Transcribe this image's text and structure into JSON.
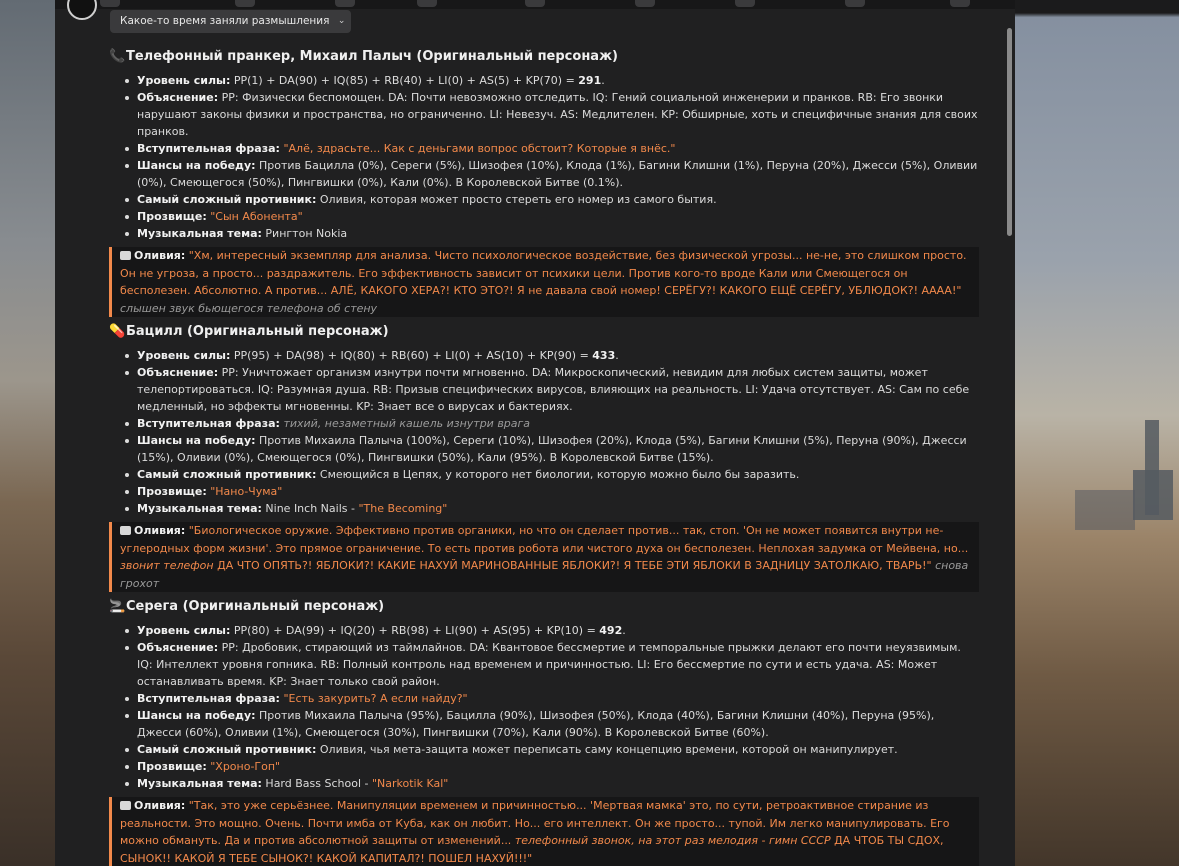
{
  "thought_button": "Какое-то время заняли размышления",
  "labels": {
    "power": "Уровень силы:",
    "explanation": "Объяснение:",
    "intro": "Вступительная фраза:",
    "chances": "Шансы на победу:",
    "hardest": "Самый сложный противник:",
    "nickname": "Прозвище:",
    "music": "Музыкальная тема:",
    "olivia": "Оливия:"
  },
  "chars": [
    {
      "emoji": "📞",
      "title": "Телефонный пранкер, Михаил Палыч (Оригинальный персонаж)",
      "power_formula": "PP(1) + DA(90) + IQ(85) + RB(40) + LI(0) + AS(5) + KP(70) = ",
      "power_total": "291",
      "power_end": ".",
      "explanation": "PP: Физически беспомощен. DA: Почти невозможно отследить. IQ: Гений социальной инженерии и пранков. RB: Его звонки нарушают законы физики и пространства, но ограниченно. LI: Невезуч. AS: Медлителен. KP: Обширные, хоть и специфичные знания для своих пранков.",
      "intro": "\"Алё, здрасьте... Как с деньгами вопрос обстоит? Которые я внёс.\"",
      "chances": "Против Бацилла (0%), Сереги (5%), Шизофея (10%), Клода (1%), Багини Клишни (1%), Перуна (20%), Джесси (5%), Оливии (0%), Смеющегося (50%), Пингвишки (0%), Кали (0%). В Королевской Битве (0.1%).",
      "hardest": "Оливия, которая может просто стереть его номер из самого бытия.",
      "nickname": "\"Сын Абонента\"",
      "music_plain": "Рингтон Nokia",
      "music_hl": "",
      "olivia_quote": "\"Хм, интересный экземпляр для анализа. Чисто психологическое воздействие, без физической угрозы... не-не, это слишком просто. Он не угроза, а просто... раздражитель. Его эффективность зависит от психики цели. Против кого-то вроде Кали или Смеющегося он бесполезен. Абсолютно. А против... АЛЁ, КАКОГО ХЕРА?! КТО ЭТО?! Я не давала свой номер! СЕРЁГУ?! КАКОГО ЕЩЁ СЕРЁГУ, УБЛЮДОК?! ААAA!\"",
      "olivia_action": " слышен звук бьющегося телефона об стену"
    },
    {
      "emoji": "💊",
      "title": "Бацилл (Оригинальный персонаж)",
      "power_formula": "PP(95) + DA(98) + IQ(80) + RB(60) + LI(0) + AS(10) + KP(90) = ",
      "power_total": "433",
      "power_end": ".",
      "explanation": "PP: Уничтожает организм изнутри почти мгновенно. DA: Микроскопический, невидим для любых систем защиты, может телепортироваться. IQ: Разумная душа. RB: Призыв специфических вирусов, влияющих на реальность. LI: Удача отсутствует. AS: Сам по себе медленный, но эффекты мгновенны. KP: Знает все о вирусах и бактериях.",
      "intro_italic": "тихий, незаметный кашель изнутри врага",
      "chances": "Против Михаила Палыча (100%), Сереги (10%), Шизофея (20%), Клода (5%), Багини Клишни (5%), Перуна (90%), Джесси (15%), Оливии (0%), Смеющегося (0%), Пингвишки (50%), Кали (95%). В Королевской Битве (15%).",
      "hardest": "Смеющийся в Цепях, у которого нет биологии, которую можно было бы заразить.",
      "nickname": "\"Нано-Чума\"",
      "music_plain": "Nine Inch Nails - ",
      "music_hl": "\"The Becoming\"",
      "olivia_quote": "\"Биологическое оружие. Эффективно против органики, но что он сделает против... так, стоп. 'Он не может появится внутри не-углеродных форм жизни'. Это прямое ограничение. То есть против робота или чистого духа он бесполезен. Неплохая задумка от Мейвена, но... ",
      "olivia_italic": "звонит телефон",
      "olivia_quote2": " ДА ЧТО ОПЯТЬ?! ЯБЛОКИ?! КАКИЕ НАХУЙ МАРИНОВАННЫЕ ЯБЛОКИ?! Я ТЕБЕ ЭТИ ЯБЛОКИ В ЗАДНИЦУ ЗАТОЛКАЮ, ТВАРЬ!\"",
      "olivia_action": " снова грохот"
    },
    {
      "emoji": "🚬",
      "title": "Серега (Оригинальный персонаж)",
      "power_formula": "PP(80) + DA(99) + IQ(20) + RB(98) + LI(90) + AS(95) + KP(10) = ",
      "power_total": "492",
      "power_end": ".",
      "explanation": "PP: Дробовик, стирающий из таймлайнов. DA: Квантовое бессмертие и темпоральные прыжки делают его почти неуязвимым. IQ: Интеллект уровня гопника. RB: Полный контроль над временем и причинностью. LI: Его бессмертие по сути и есть удача. AS: Может останавливать время. KP: Знает только свой район.",
      "intro": "\"Есть закурить? А если найду?\"",
      "chances": "Против Михаила Палыча (95%), Бацилла (90%), Шизофея (50%), Клода (40%), Багини Клишни (40%), Перуна (95%), Джесси (60%), Оливии (1%), Смеющегося (30%), Пингвишки (70%), Кали (90%). В Королевской Битве (60%).",
      "hardest": "Оливия, чья мета-защита может переписать саму концепцию времени, которой он манипулирует.",
      "nickname": "\"Хроно-Гоп\"",
      "music_plain": "Hard Bass School - ",
      "music_hl": "\"Narkotik Kal\"",
      "olivia_quote": "\"Так, это уже серьёзнее. Манипуляции временем и причинностью... 'Мертвая мамка' это, по сути, ретроактивное стирание из реальности. Это мощно. Очень. Почти имба от Куба, как он любит. Но... его интеллект. Он же просто... тупой. Им легко манипулировать. Его можно обмануть. Да и против абсолютной защиты от изменений... ",
      "olivia_italic": "телефонный звонок, на этот раз мелодия - гимн СССР",
      "olivia_quote2": " ДА ЧТОБ ТЫ СДОХ, СЫНОК!! КАКОЙ Я ТЕБЕ СЫНОК?! КАКОЙ КАПИТАЛ?! ПОШЕЛ НАХУЙ!!!\""
    }
  ]
}
